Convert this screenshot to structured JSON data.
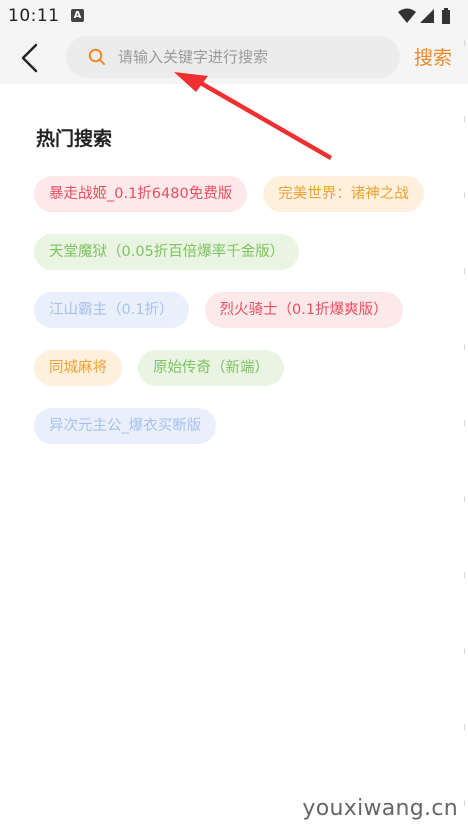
{
  "status_bar": {
    "time": "10:11",
    "notification_letter": "A",
    "icons": [
      "wifi-icon",
      "signal-icon",
      "battery-icon"
    ]
  },
  "header": {
    "back_icon": "chevron-left-icon",
    "search_icon": "search-icon",
    "search_placeholder": "请输入关键字进行搜索",
    "search_value": "",
    "search_button_label": "搜索"
  },
  "hot_search": {
    "title": "热门搜索",
    "rows": [
      [
        {
          "label": "暴走战姬_0.1折6480免费版",
          "text_color": "#e85060",
          "bg_color": "#fde8ea"
        },
        {
          "label": "完美世界：诸神之战",
          "text_color": "#f0a232",
          "bg_color": "#fdf1dd"
        }
      ],
      [
        {
          "label": "天堂魔狱（0.05折百倍爆率千金版）",
          "text_color": "#7fc260",
          "bg_color": "#e9f4e3"
        }
      ],
      [
        {
          "label": "江山霸主（0.1折）",
          "text_color": "#a8c0ec",
          "bg_color": "#eaf0fb"
        },
        {
          "label": "烈火骑士（0.1折爆爽版）",
          "text_color": "#e85060",
          "bg_color": "#fde8ea"
        }
      ],
      [
        {
          "label": "同城麻将",
          "text_color": "#f0a232",
          "bg_color": "#fdf1dd"
        },
        {
          "label": "原始传奇（新端）",
          "text_color": "#7fc260",
          "bg_color": "#e9f4e3"
        }
      ],
      [
        {
          "label": "异次元主公_爆衣买断版",
          "text_color": "#a8c0ec",
          "bg_color": "#eaf0fb"
        }
      ]
    ]
  },
  "annotation": {
    "arrow_color": "#ee3030"
  },
  "watermark": {
    "text": "youxiwang.cn"
  }
}
